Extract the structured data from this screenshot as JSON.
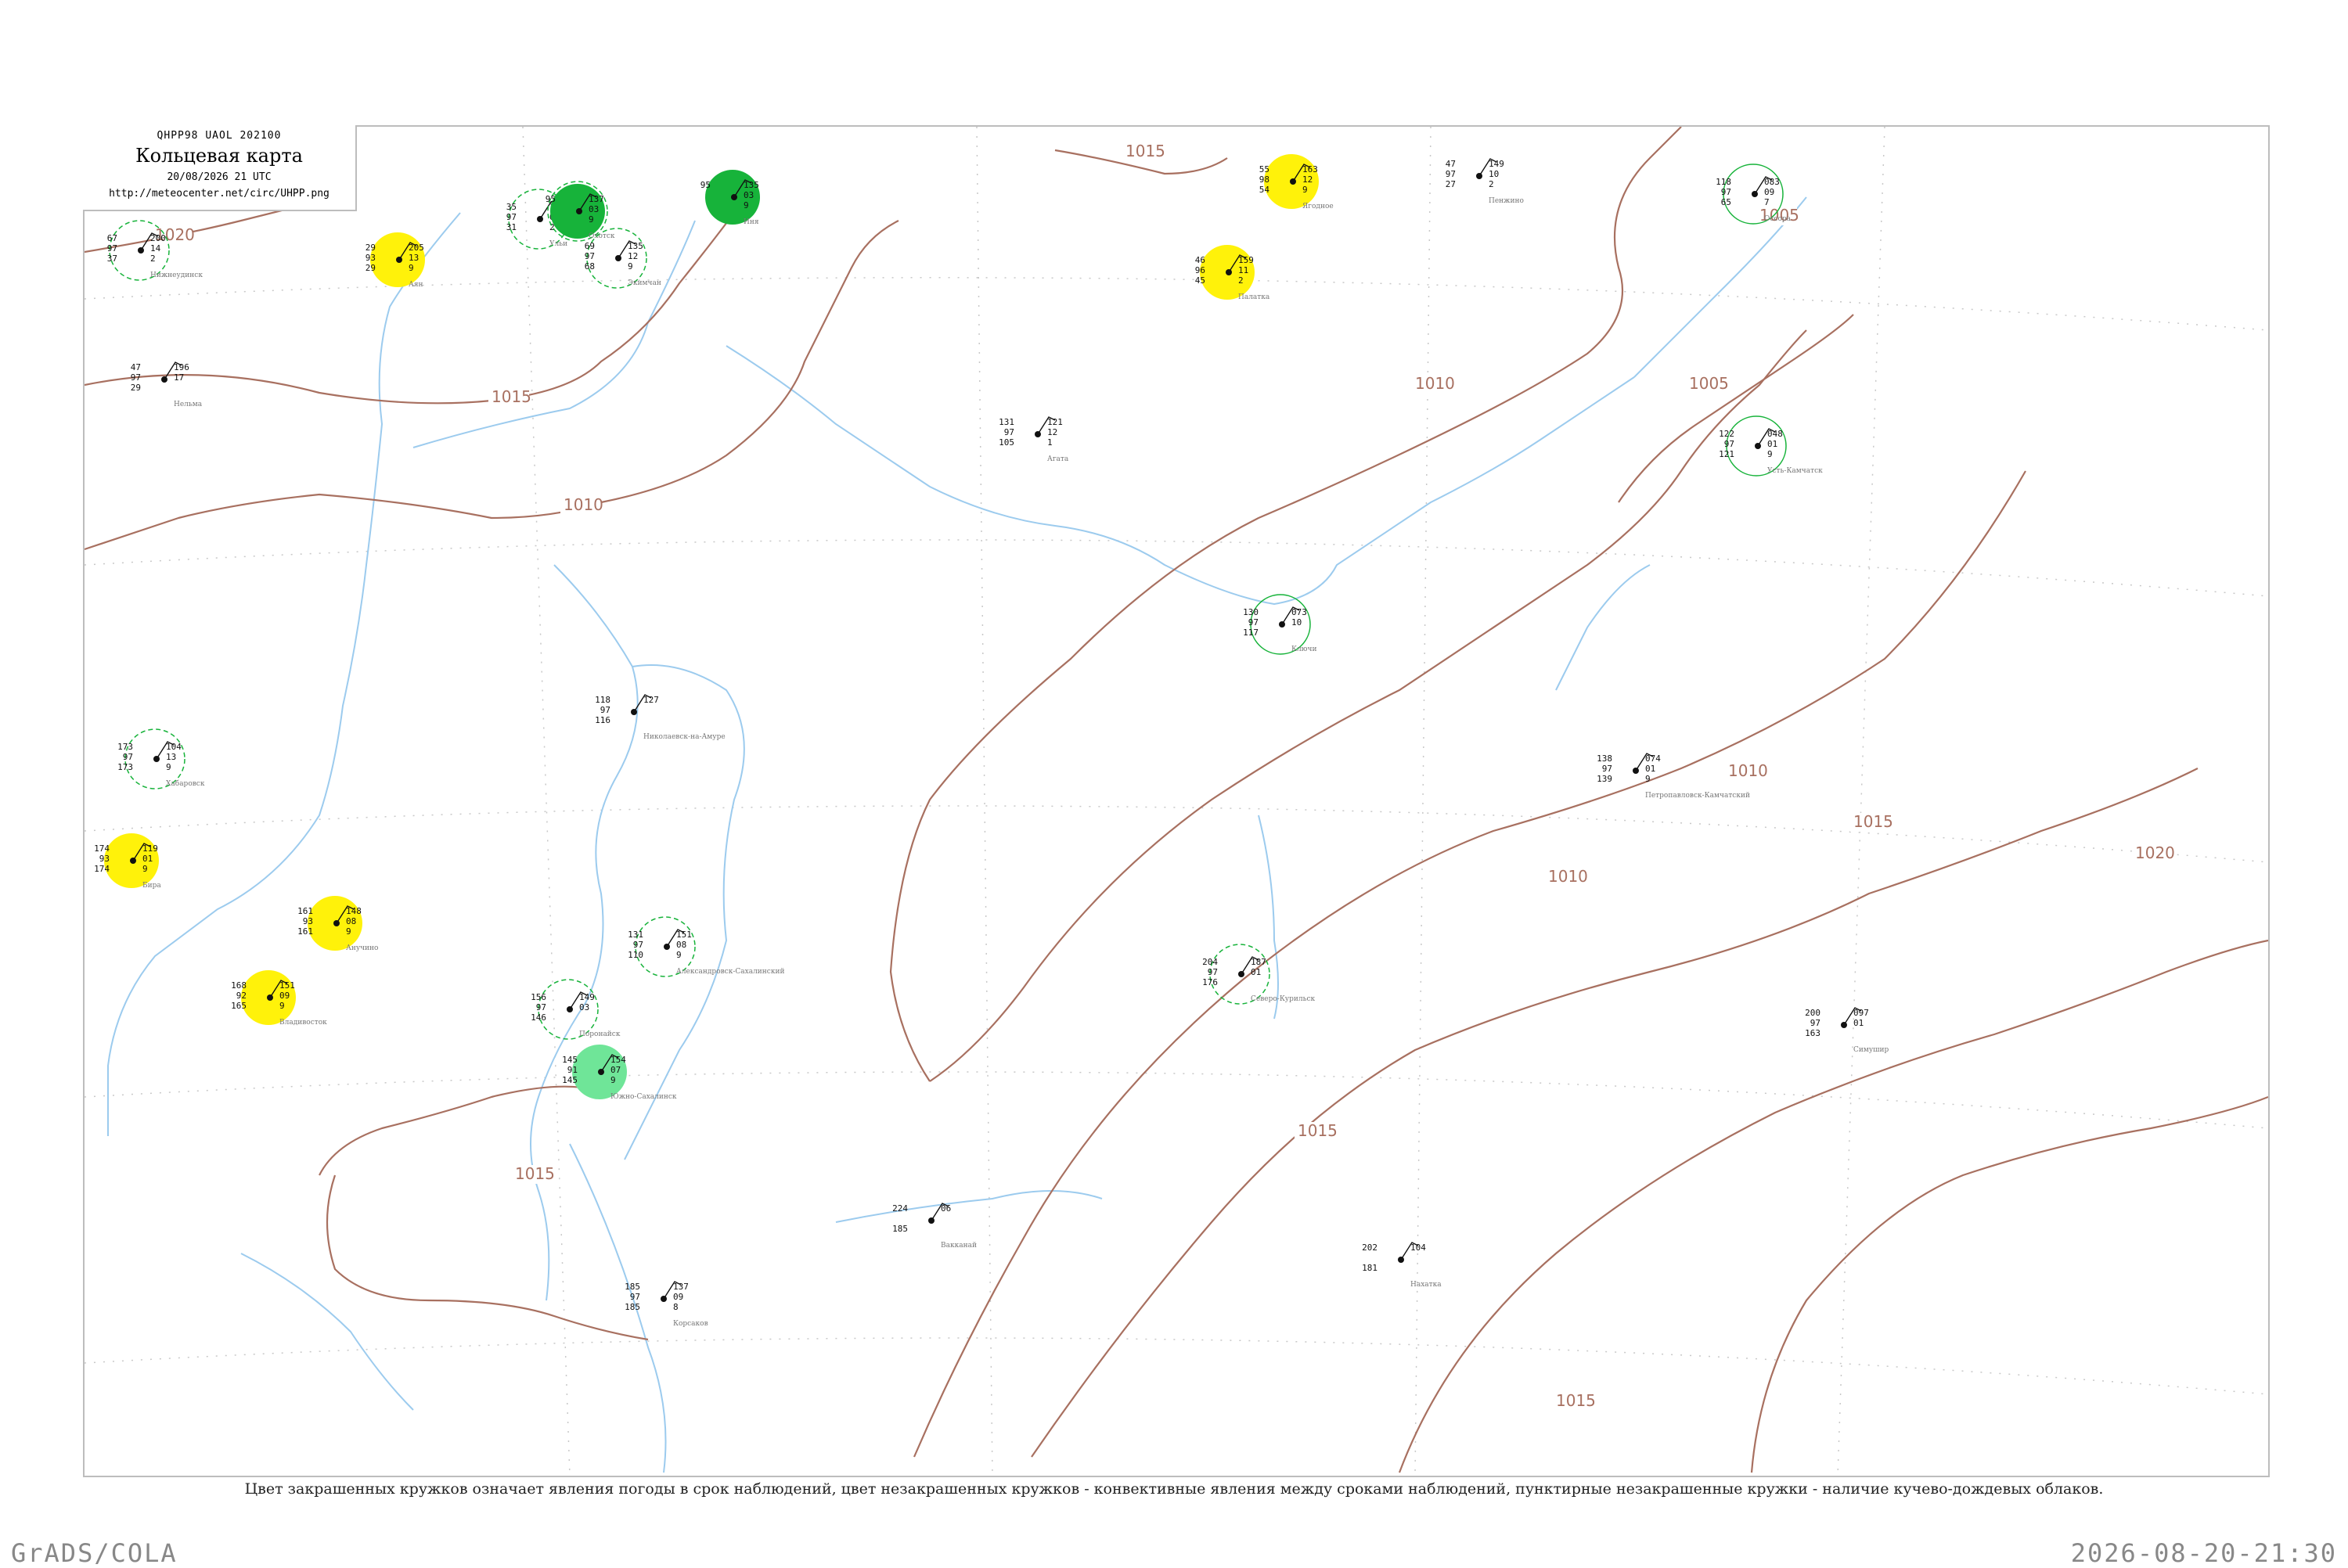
{
  "header": {
    "code": "QHPP98  UAOL  202100",
    "title": "Кольцевая карта",
    "datetime": "20/08/2026 21 UTC",
    "url": "http://meteocenter.net/circ/UHPP.png"
  },
  "caption": "Цвет закрашенных кружков означает явления погоды в срок наблюдений, цвет незакрашенных кружков - конвективные явления между сроками наблюдений, пунктирные незакрашенные кружки - наличие кучево-дождевых облаков.",
  "footer": {
    "left": "GrADS/COLA",
    "right": "2026-08-20-21:30"
  },
  "colors": {
    "isobar": "#a87060",
    "coast": "#9ccbee",
    "green": "#17b33a",
    "light_green": "#6fe598",
    "yellow": "#fff20a",
    "pale_yellow": "#fff59d",
    "grid": "#c8c8c8"
  },
  "isobar_labels": [
    "1020",
    "1015",
    "1010",
    "1015",
    "1010",
    "1005",
    "1005",
    "1010",
    "1010",
    "1015",
    "1020",
    "1015",
    "1015",
    "1015"
  ],
  "stations": [
    {
      "name": "Нижнеудинск",
      "vals": [
        "67",
        "97",
        "37"
      ],
      "vals2": [
        "200",
        "14",
        "2"
      ],
      "fill": "none",
      "ring": "dash"
    },
    {
      "name": "Аян",
      "vals": [
        "29",
        "93",
        "29"
      ],
      "vals2": [
        "205",
        "13",
        "9"
      ],
      "fill": "yellow",
      "ring": "none"
    },
    {
      "name": "Ульи",
      "vals": [
        "35",
        "97",
        "31"
      ],
      "vals2": [
        "166",
        "03",
        "2"
      ],
      "fill": "none",
      "ring": "dash"
    },
    {
      "name": "Охотск",
      "vals": [
        "95",
        "",
        ""
      ],
      "vals2": [
        "137",
        "03",
        "9"
      ],
      "fill": "green",
      "ring": "dash"
    },
    {
      "name": "Иня",
      "vals": [
        "95",
        "",
        ""
      ],
      "vals2": [
        "135",
        "03",
        "9"
      ],
      "fill": "green",
      "ring": "none"
    },
    {
      "name": "Нельма",
      "vals": [
        "47",
        "97",
        "29"
      ],
      "vals2": [
        "196",
        "17",
        ""
      ],
      "fill": "none",
      "ring": "none"
    },
    {
      "name": "Экимчан",
      "vals": [
        "69",
        "97",
        "68"
      ],
      "vals2": [
        "135",
        "12",
        "9"
      ],
      "fill": "none",
      "ring": "dash"
    },
    {
      "name": "Ягодное",
      "vals": [
        "55",
        "98",
        "54"
      ],
      "vals2": [
        "163",
        "12",
        "9"
      ],
      "fill": "yellow",
      "ring": "none"
    },
    {
      "name": "Палатка",
      "vals": [
        "46",
        "96",
        "45"
      ],
      "vals2": [
        "159",
        "11",
        "2"
      ],
      "fill": "yellow",
      "ring": "none"
    },
    {
      "name": "Пенжино",
      "vals": [
        "47",
        "97",
        "27"
      ],
      "vals2": [
        "149",
        "10",
        "2"
      ],
      "fill": "none",
      "ring": "none"
    },
    {
      "name": "Оссора",
      "vals": [
        "118",
        "97",
        "65"
      ],
      "vals2": [
        "083",
        "09",
        "7"
      ],
      "fill": "none",
      "ring": "solid-green"
    },
    {
      "name": "Усть-Камчатск",
      "vals": [
        "122",
        "97",
        "121"
      ],
      "vals2": [
        "048",
        "01",
        "9"
      ],
      "fill": "none",
      "ring": "solid-green"
    },
    {
      "name": "Николаевск-на-Амуре",
      "vals": [
        "118",
        "97",
        "116"
      ],
      "vals2": [
        "127",
        "",
        ""
      ],
      "fill": "none",
      "ring": "none"
    },
    {
      "name": "Хабаровск",
      "vals": [
        "173",
        "97",
        "173"
      ],
      "vals2": [
        "104",
        "13",
        "9"
      ],
      "fill": "none",
      "ring": "dash"
    },
    {
      "name": "Бира",
      "vals": [
        "174",
        "93",
        "174"
      ],
      "vals2": [
        "119",
        "01",
        "9"
      ],
      "fill": "yellow",
      "ring": "none"
    },
    {
      "name": "Анучино",
      "vals": [
        "161",
        "93",
        "161"
      ],
      "vals2": [
        "148",
        "08",
        "9"
      ],
      "fill": "yellow",
      "ring": "none"
    },
    {
      "name": "Владивосток",
      "vals": [
        "168",
        "92",
        "165"
      ],
      "vals2": [
        "151",
        "09",
        "9"
      ],
      "fill": "yellow",
      "ring": "none"
    },
    {
      "name": "Южно-Сахалинск",
      "vals": [
        "145",
        "91",
        "145"
      ],
      "vals2": [
        "154",
        "07",
        "9"
      ],
      "fill": "light_green",
      "ring": "none"
    },
    {
      "name": "Поронайск",
      "vals": [
        "156",
        "97",
        "146"
      ],
      "vals2": [
        "149",
        "03",
        ""
      ],
      "fill": "none",
      "ring": "dash"
    },
    {
      "name": "Александровск-Сахалинский",
      "vals": [
        "131",
        "97",
        "110"
      ],
      "vals2": [
        "151",
        "08",
        "9"
      ],
      "fill": "none",
      "ring": "dash"
    },
    {
      "name": "Ключи",
      "vals": [
        "130",
        "97",
        "117"
      ],
      "vals2": [
        "073",
        "10",
        ""
      ],
      "fill": "none",
      "ring": "solid-green"
    },
    {
      "name": "Петропавловск-Камчатский",
      "vals": [
        "138",
        "97",
        "139"
      ],
      "vals2": [
        "074",
        "01",
        "9"
      ],
      "fill": "none",
      "ring": "none"
    },
    {
      "name": "Северо-Курильск",
      "vals": [
        "204",
        "97",
        "176"
      ],
      "vals2": [
        "187",
        "01",
        ""
      ],
      "fill": "none",
      "ring": "dash"
    },
    {
      "name": "Вакканай",
      "vals": [
        "224",
        "",
        "185"
      ],
      "vals2": [
        "06",
        "",
        ""
      ],
      "fill": "none",
      "ring": "none"
    },
    {
      "name": "Симушир",
      "vals": [
        "200",
        "97",
        "163"
      ],
      "vals2": [
        "097",
        "01",
        ""
      ],
      "fill": "none",
      "ring": "none"
    },
    {
      "name": "Нахатка",
      "vals": [
        "202",
        "",
        "181"
      ],
      "vals2": [
        "104",
        "",
        ""
      ],
      "fill": "none",
      "ring": "none"
    },
    {
      "name": "Корсаков",
      "vals": [
        "185",
        "97",
        "185"
      ],
      "vals2": [
        "137",
        "09",
        "8"
      ],
      "fill": "none",
      "ring": "none"
    },
    {
      "name": "Агата",
      "vals": [
        "131",
        "97",
        "105"
      ],
      "vals2": [
        "121",
        "12",
        "1"
      ],
      "fill": "none",
      "ring": "none"
    }
  ],
  "legend_note": ""
}
